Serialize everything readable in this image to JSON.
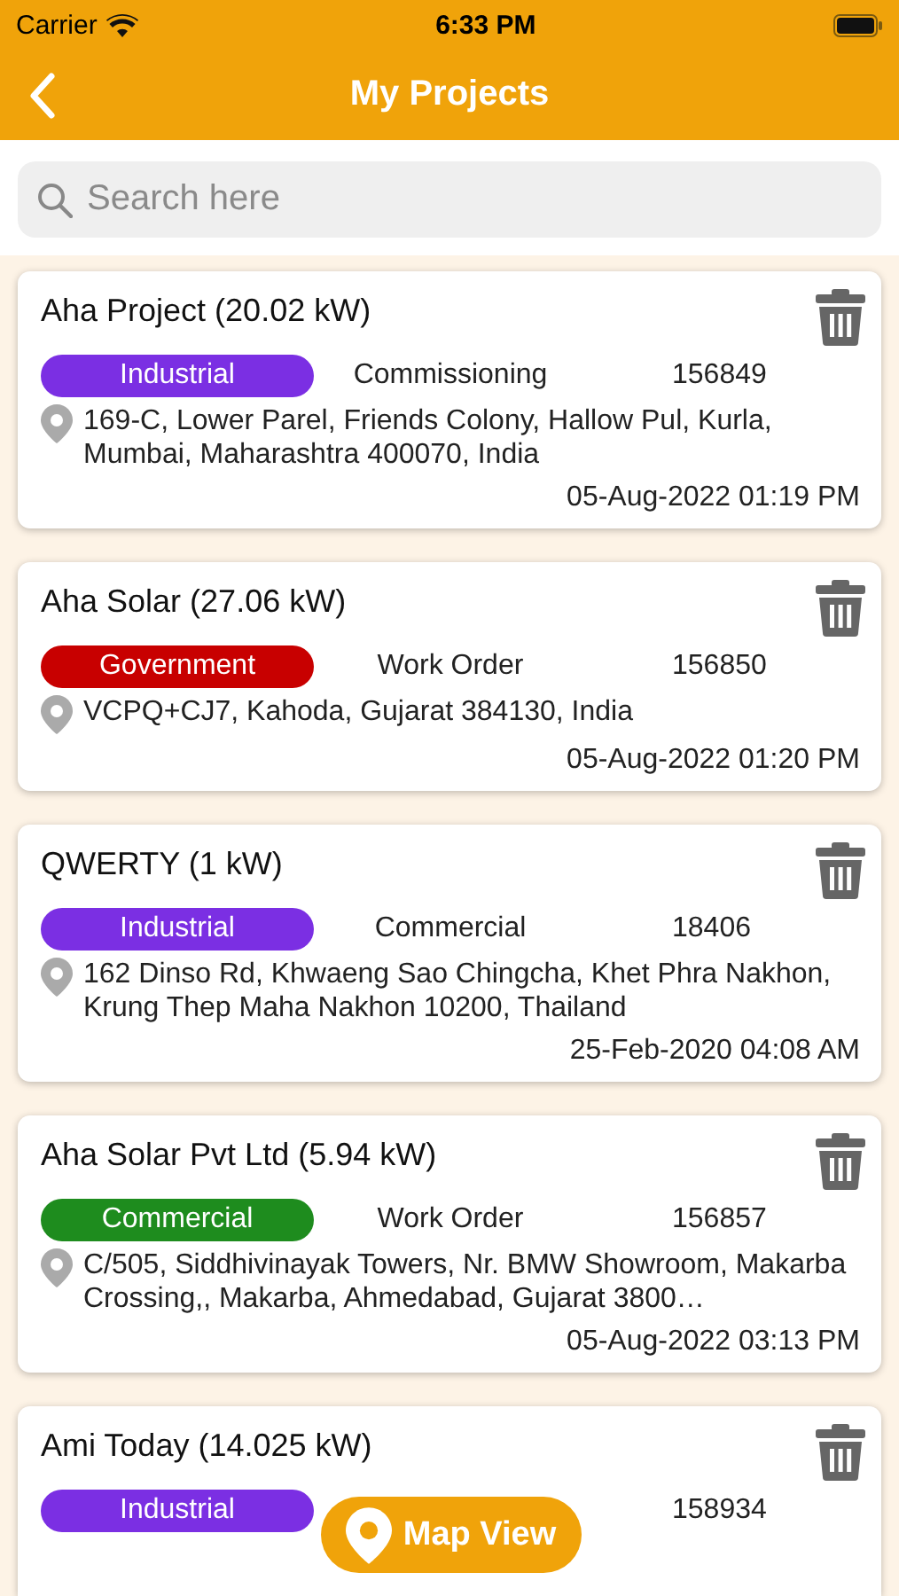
{
  "status_bar": {
    "carrier": "Carrier",
    "time": "6:33 PM"
  },
  "nav": {
    "title": "My Projects"
  },
  "search": {
    "placeholder": "Search here"
  },
  "projects": [
    {
      "title": "Aha Project (20.02 kW)",
      "category": "Industrial",
      "color": "#7b2fe3",
      "status": "Commissioning",
      "number": "156849",
      "address": "169-C, Lower Parel, Friends Colony, Hallow Pul, Kurla, Mumbai, Maharashtra 400070, India",
      "date": "05-Aug-2022 01:19 PM"
    },
    {
      "title": "Aha Solar (27.06 kW)",
      "category": "Government",
      "color": "#c80000",
      "status": "Work Order",
      "number": "156850",
      "address": "VCPQ+CJ7, Kahoda, Gujarat 384130, India",
      "date": "05-Aug-2022 01:20 PM"
    },
    {
      "title": "QWERTY (1 kW)",
      "category": "Industrial",
      "color": "#7b2fe3",
      "status": "Commercial",
      "number": "18406",
      "address": "162 Dinso Rd, Khwaeng Sao Chingcha, Khet Phra Nakhon, Krung Thep Maha Nakhon 10200, Thailand",
      "date": "25-Feb-2020 04:08 AM"
    },
    {
      "title": "Aha Solar Pvt Ltd (5.94 kW)",
      "category": "Commercial",
      "color": "#1e8c1e",
      "status": "Work Order",
      "number": "156857",
      "address": "C/505, Siddhivinayak Towers, Nr. BMW Showroom, Makarba Crossing,, Makarba, Ahmedabad, Gujarat 3800…",
      "date": "05-Aug-2022 03:13 PM"
    },
    {
      "title": "Ami Today (14.025 kW)",
      "category": "Industrial",
      "color": "#7b2fe3",
      "number": "158934"
    }
  ],
  "map_button": {
    "label": "Map View"
  }
}
